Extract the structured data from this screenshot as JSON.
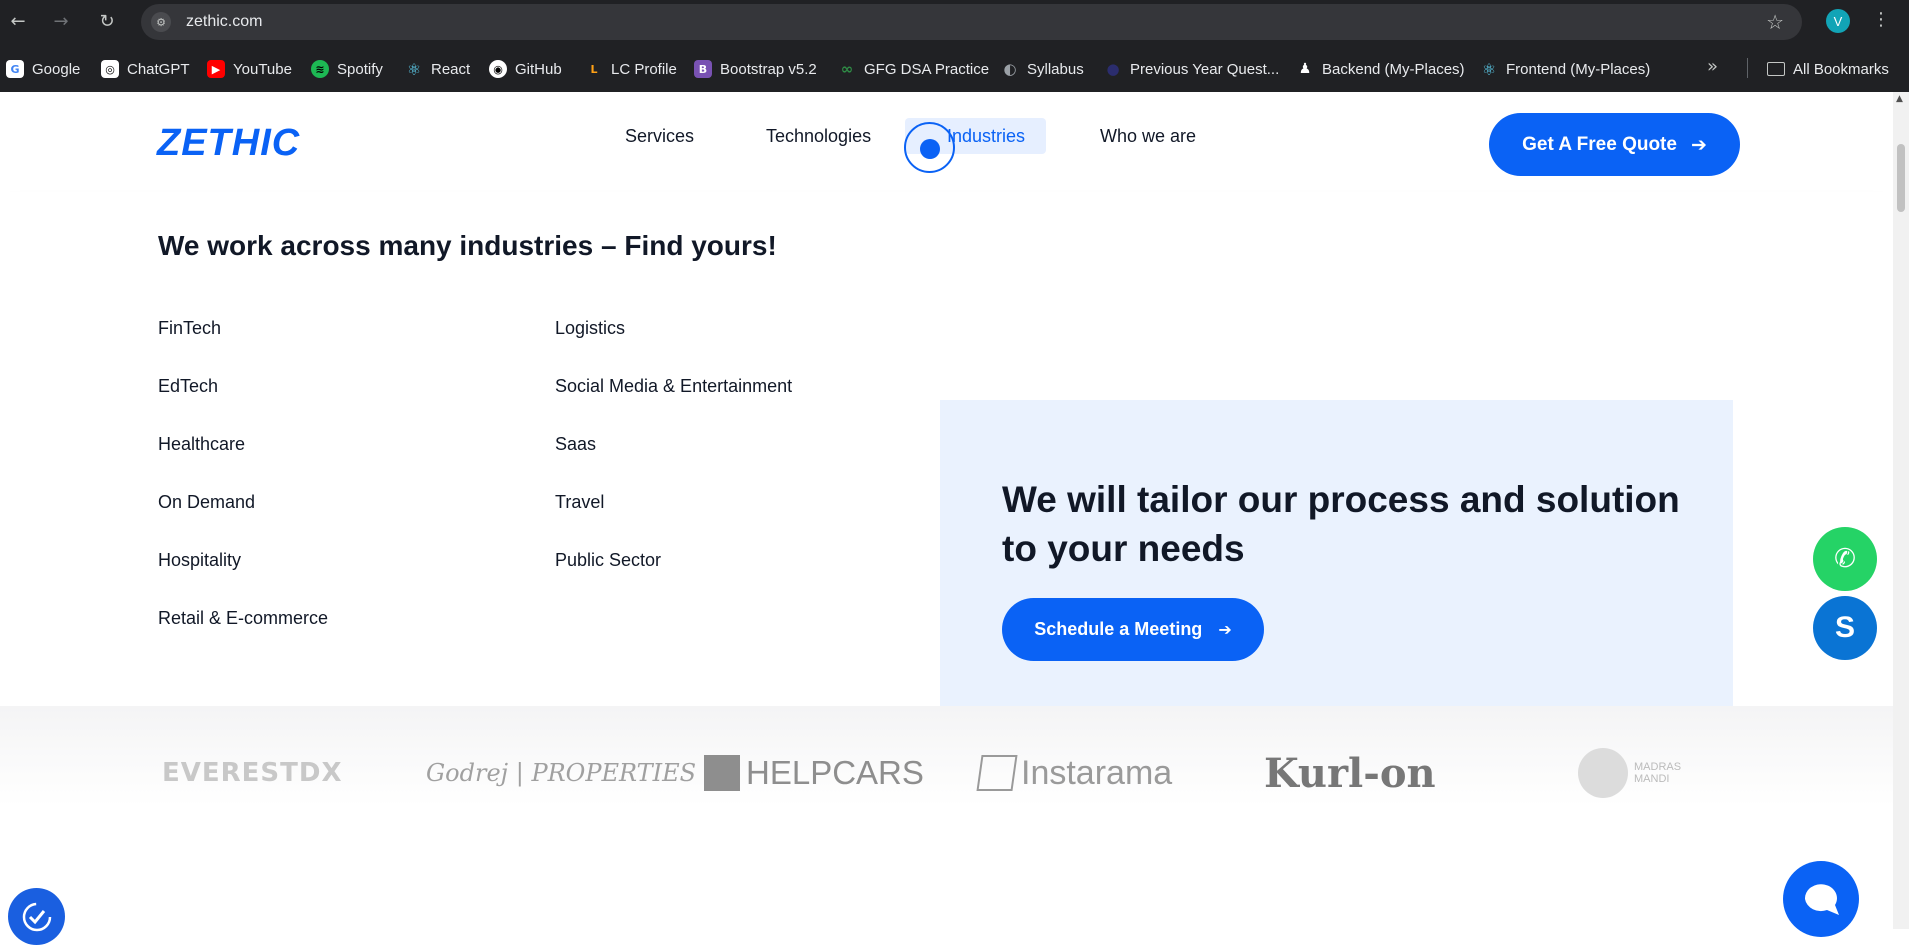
{
  "browser": {
    "url": "zethic.com",
    "profile_initial": "V",
    "nav": {
      "back": "←",
      "forward": "→",
      "reload": "↻",
      "star": "☆",
      "menu": "⋮",
      "site_info": "⚙"
    },
    "bookmarks": [
      {
        "label": "Google",
        "icon": "G",
        "color": "#ffffff"
      },
      {
        "label": "ChatGPT",
        "icon": "◎",
        "color": "#ffffff"
      },
      {
        "label": "YouTube",
        "icon": "▶",
        "color": "#ff0000"
      },
      {
        "label": "Spotify",
        "icon": "≋",
        "color": "#1db954"
      },
      {
        "label": "React",
        "icon": "⚛",
        "color": "#61dafb"
      },
      {
        "label": "GitHub",
        "icon": "◉",
        "color": "#ffffff"
      },
      {
        "label": "LC Profile",
        "icon": "L",
        "color": "#ffa116"
      },
      {
        "label": "Bootstrap v5.2",
        "icon": "B",
        "color": "#7952b3"
      },
      {
        "label": "GFG DSA Practice",
        "icon": "∞",
        "color": "#2f8d46"
      },
      {
        "label": "Syllabus",
        "icon": "◐",
        "color": "#9aa0a6"
      },
      {
        "label": "Previous Year Quest...",
        "icon": "●",
        "color": "#2b2d6e"
      },
      {
        "label": "Backend (My-Places)",
        "icon": "♟",
        "color": "#ffffff"
      },
      {
        "label": "Frontend (My-Places)",
        "icon": "⚛",
        "color": "#61dafb"
      }
    ],
    "more_bookmarks": "»",
    "all_bookmarks": "All Bookmarks"
  },
  "site": {
    "logo": "ZETHIC",
    "nav": [
      "Services",
      "Technologies",
      "Industries",
      "Who we are"
    ],
    "active_nav": "Industries",
    "cta": "Get A Free Quote",
    "arrow": "➔"
  },
  "mega_menu": {
    "title": "We work across many industries – Find yours!",
    "column_1": [
      "FinTech",
      "EdTech",
      "Healthcare",
      "On Demand",
      "Hospitality",
      "Retail & E-commerce"
    ],
    "column_2": [
      "Logistics",
      "Social Media & Entertainment",
      "Saas",
      "Travel",
      "Public Sector"
    ],
    "tailor_text": "We will tailor our process and solution to your needs",
    "meeting_button": "Schedule a Meeting"
  },
  "client_logos": [
    "EVERESTDX",
    "Godrej | PROPERTIES",
    "HELPCARS",
    "Instarama",
    "Kurl-on",
    "MADRAS MANDI"
  ],
  "colors": {
    "brand_blue": "#0a62f5",
    "whatsapp_green": "#25d366",
    "skype_blue": "#0a74d4",
    "panel_bg": "#eaf2fe"
  }
}
